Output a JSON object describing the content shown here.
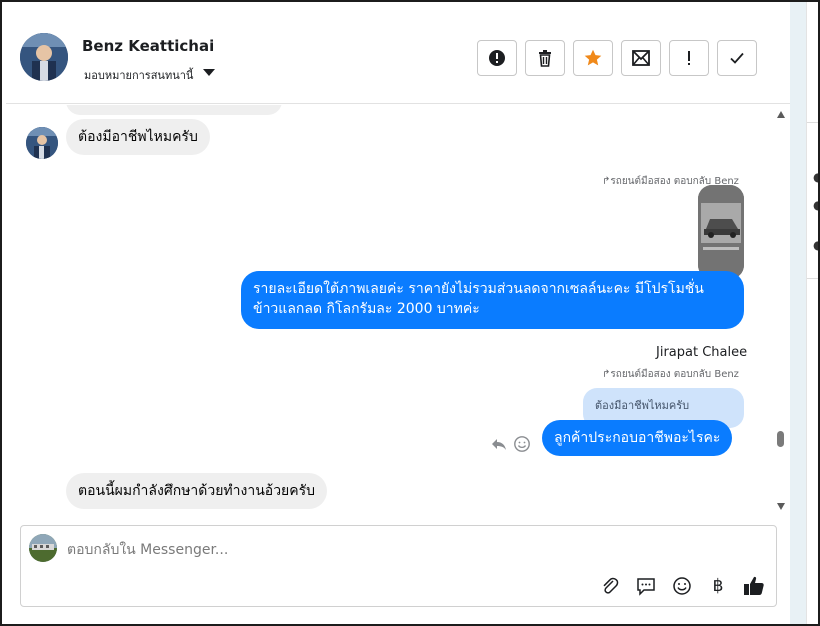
{
  "header": {
    "contact_name": "Benz Keattichai",
    "assign_label": "มอบหมายการสนทนานี้"
  },
  "toolbar": {
    "buttons": [
      {
        "name": "report-icon",
        "glyph": "!"
      },
      {
        "name": "delete-icon",
        "glyph": ""
      },
      {
        "name": "star-icon",
        "glyph": "★"
      },
      {
        "name": "mark-unread-icon",
        "glyph": ""
      },
      {
        "name": "spam-icon",
        "glyph": "!"
      },
      {
        "name": "done-icon",
        "glyph": "✓"
      }
    ]
  },
  "messages": {
    "m1_text": "ต้องมีอาชีพไหมครับ",
    "m2_reply_note": "รถยนต์มือสอง ตอบกลับ Benz",
    "m2_text_line1": "รายละเอียดใต้ภาพเลยค่ะ ราคายังไม่รวมส่วนลดจากเซลล์นะคะ มีโปรโมชั่น",
    "m2_text_line2": "ข้าวแลกลด กิโลกรัมละ 2000 บาทค่ะ",
    "m3_sender": "Jirapat Chalee",
    "m3_reply_note": "รถยนต์มือสอง ตอบกลับ Benz",
    "m3_quoted": "ต้องมีอาชีพไหมครับ",
    "m3_text": "ลูกค้าประกอบอาชีพอะไรคะ",
    "m4_text": "ตอนนี้ผมกำลังศึกษาด้วยทำงานอ้วยครับ"
  },
  "composer": {
    "placeholder": "ตอบกลับใน Messenger...",
    "currency_glyph": "฿"
  },
  "colors": {
    "outgoing_bubble": "#0a7cff",
    "incoming_bubble": "#efefef",
    "quoted_bubble": "#cfe3fb",
    "star": "#f0891a",
    "like": "#1c1e21"
  }
}
